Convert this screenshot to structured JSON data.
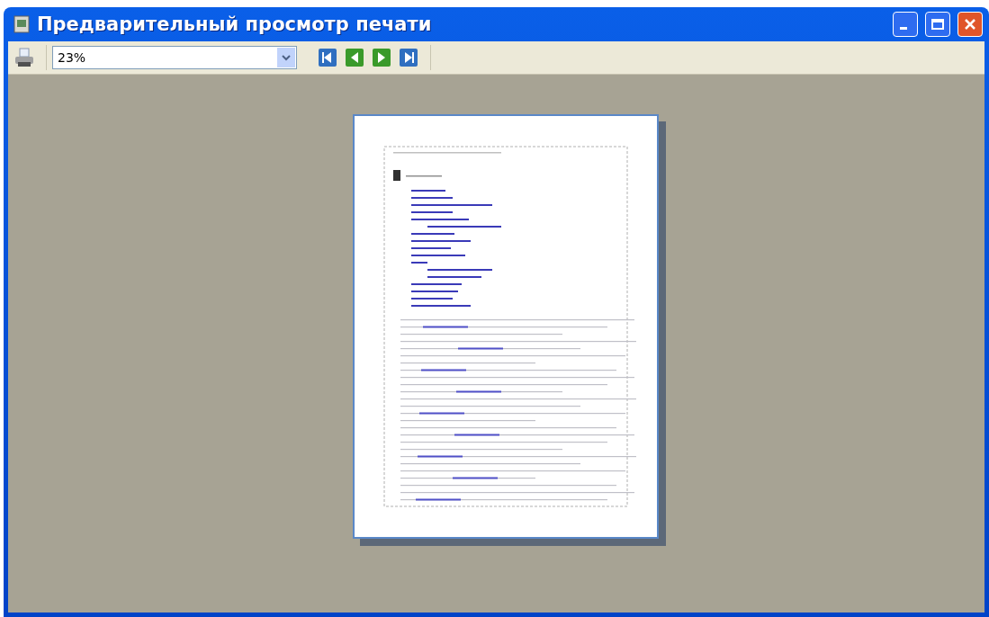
{
  "window": {
    "title": "Предварительный просмотр печати"
  },
  "toolbar": {
    "zoom": {
      "value": "23%"
    },
    "nav_buttons": [
      {
        "kind": "first"
      },
      {
        "kind": "prev"
      },
      {
        "kind": "next"
      },
      {
        "kind": "last"
      }
    ]
  },
  "preview": {
    "kind": "page"
  }
}
